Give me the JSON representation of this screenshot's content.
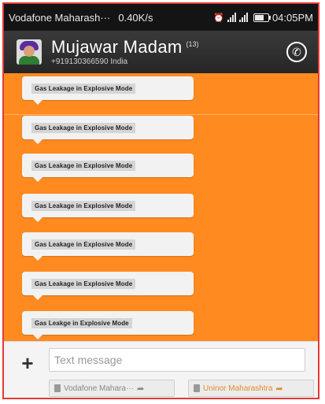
{
  "status_bar": {
    "carrier": "Vodafone Maharash···",
    "speed": "0.40K/s",
    "time": "04:05PM"
  },
  "header": {
    "contact_name": "Mujawar Madam",
    "message_count": "(13)",
    "phone_number": "+919130366590 India"
  },
  "messages": [
    {
      "text": "Gas Leakage in Explosive Mode"
    },
    {
      "text": "Gas Leakage in Explosive Mode"
    },
    {
      "text": "Gas Leakage in Explosive Mode"
    },
    {
      "text": "Gas Leakage in Explosive Mode"
    },
    {
      "text": "Gas Leakage in Explosive Mode"
    },
    {
      "text": "Gas Leakage in Explosive Mode"
    },
    {
      "text": "Gas Leakge in Explosive Mode"
    }
  ],
  "compose": {
    "placeholder": "Text message",
    "sim1_label": "Vodafone Mahara···",
    "sim2_label": "Uninor Maharashtra"
  },
  "colors": {
    "background": "#ff8a1f",
    "header": "#2f2f2f",
    "bubble": "#f2f2f2",
    "sim2_accent": "#e58a2c"
  },
  "icons": {
    "call": "phone-icon",
    "attach": "plus-icon",
    "send": "send-arrow-icon"
  }
}
